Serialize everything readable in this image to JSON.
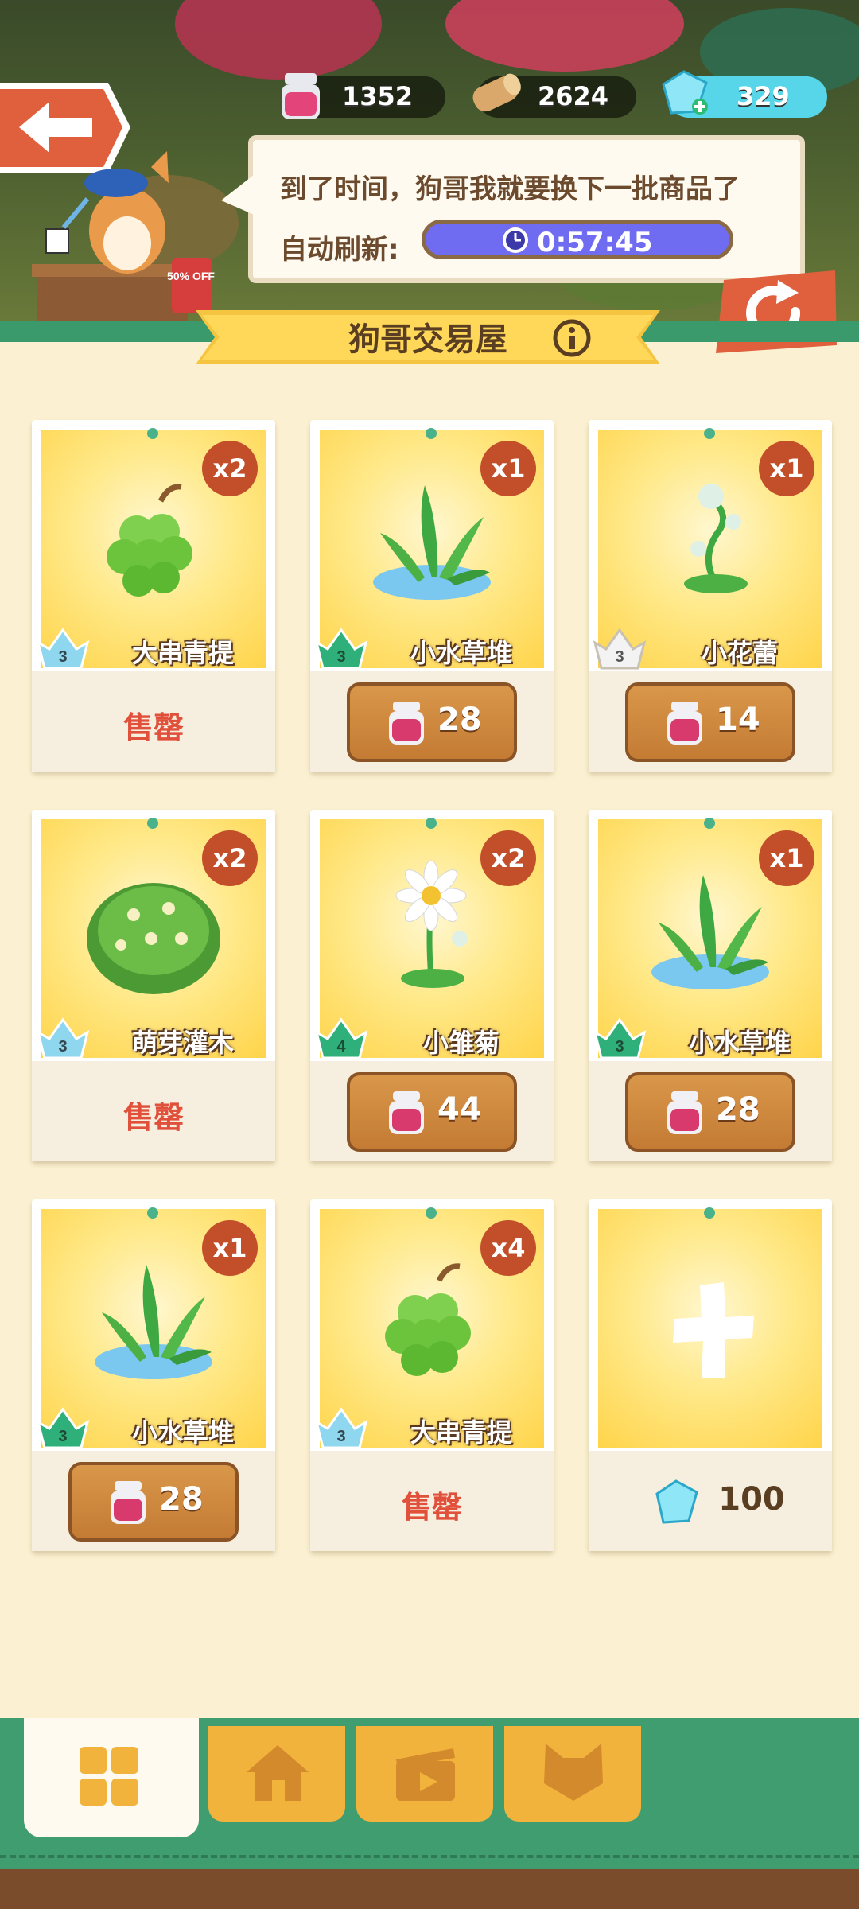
{
  "resources": {
    "jam": {
      "icon": "jam-jar-icon",
      "value": "1352"
    },
    "wood": {
      "icon": "wood-log-icon",
      "value": "2624"
    },
    "gem": {
      "icon": "gem-icon",
      "value": "329"
    }
  },
  "npc": {
    "message": "到了时间，狗哥我就要换下一批商品了",
    "refresh_label": "自动刷新:",
    "timer": "0:57:45",
    "sign": "50% OFF"
  },
  "shop": {
    "title": "狗哥交易屋"
  },
  "items": [
    {
      "name": "大串青提",
      "qty": "x2",
      "level": "3",
      "level_color": "#8fd6ef",
      "status": "售罄",
      "price": "",
      "plant": "grapes-icon"
    },
    {
      "name": "小水草堆",
      "qty": "x1",
      "level": "3",
      "level_color": "#2fb07a",
      "status": "",
      "price": "28",
      "plant": "water-grass-icon"
    },
    {
      "name": "小花蕾",
      "qty": "x1",
      "level": "3",
      "level_color": "#f3f3f3",
      "status": "",
      "price": "14",
      "plant": "flower-bud-icon"
    },
    {
      "name": "萌芽灌木",
      "qty": "x2",
      "level": "3",
      "level_color": "#8fd6ef",
      "status": "售罄",
      "price": "",
      "plant": "bush-icon"
    },
    {
      "name": "小雏菊",
      "qty": "x2",
      "level": "4",
      "level_color": "#2fb07a",
      "status": "",
      "price": "44",
      "plant": "daisy-icon"
    },
    {
      "name": "小水草堆",
      "qty": "x1",
      "level": "3",
      "level_color": "#2fb07a",
      "status": "",
      "price": "28",
      "plant": "water-grass-icon"
    },
    {
      "name": "小水草堆",
      "qty": "x1",
      "level": "3",
      "level_color": "#2fb07a",
      "status": "",
      "price": "28",
      "plant": "water-grass-icon"
    },
    {
      "name": "大串青提",
      "qty": "x4",
      "level": "3",
      "level_color": "#8fd6ef",
      "status": "售罄",
      "price": "",
      "plant": "grapes-icon"
    }
  ],
  "add_slot": {
    "price": "100",
    "icon": "plus-icon",
    "currency_icon": "gem-icon"
  },
  "nav": [
    {
      "icon": "grid-icon",
      "active": true
    },
    {
      "icon": "house-icon",
      "active": false
    },
    {
      "icon": "clapperboard-icon",
      "active": false
    },
    {
      "icon": "cat-head-icon",
      "active": false
    }
  ],
  "colors": {
    "accent_red": "#e0503b",
    "nav_green": "#3f9d70",
    "timer_blue": "#6f6cf2",
    "banner_gold": "#f5c542"
  }
}
